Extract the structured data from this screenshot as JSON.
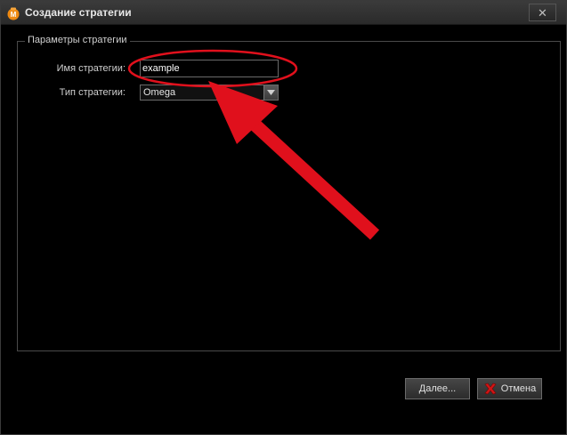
{
  "window": {
    "title": "Создание стратегии",
    "close_glyph": "✕",
    "icon": "moneybag-app-icon"
  },
  "group": {
    "legend": "Параметры стратегии"
  },
  "fields": {
    "name_label": "Имя стратегии:",
    "name_value": "example",
    "type_label": "Тип стратегии:",
    "type_value": "Omega"
  },
  "buttons": {
    "next_label": "Далее...",
    "cancel_label": "Отмена"
  },
  "colors": {
    "annotation": "#e0101c",
    "background": "#000000"
  }
}
